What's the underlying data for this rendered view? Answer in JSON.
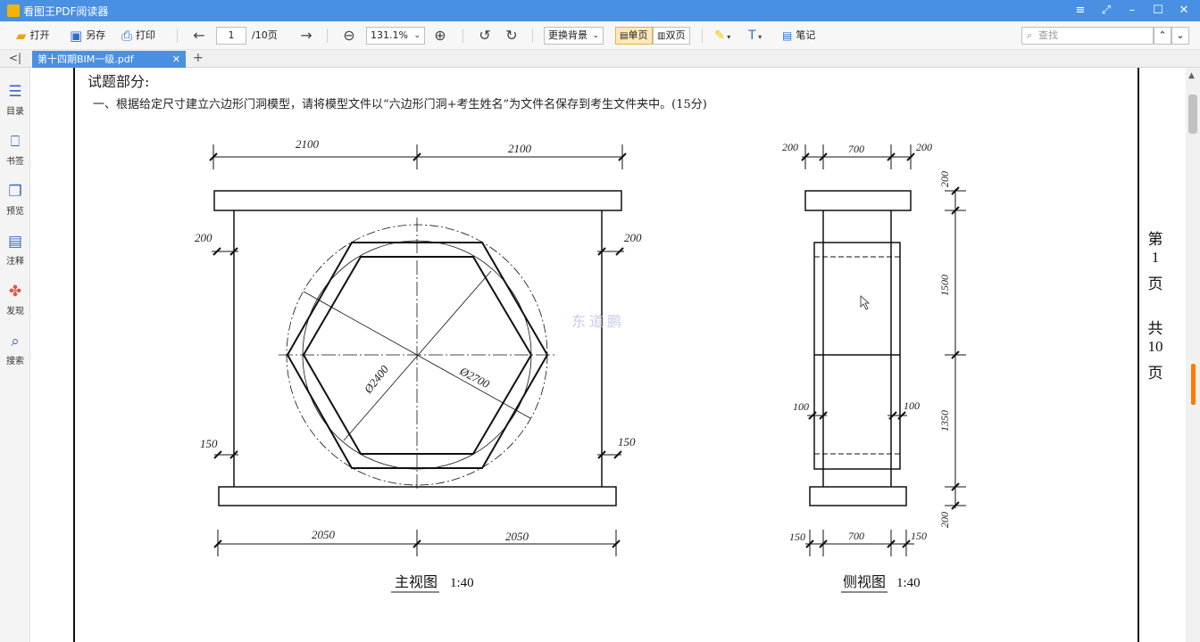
{
  "window": {
    "title": "看图王PDF阅读器",
    "controls": [
      "≡",
      "⤢",
      "–",
      "☐",
      "✕"
    ]
  },
  "toolbar": {
    "open": "打开",
    "save_as": "另存",
    "print": "打印",
    "page_input": "1",
    "page_total": "/10页",
    "zoom": "131.1%",
    "bg_label": "更换背景",
    "single": "单页",
    "double": "双页",
    "note": "笔记",
    "search_placeholder": "查找"
  },
  "tabs": {
    "active": "第十四期BIM一级.pdf"
  },
  "sidebar": {
    "items": [
      {
        "label": "目录",
        "icon": "toc-icon"
      },
      {
        "label": "书签",
        "icon": "bookmark-icon"
      },
      {
        "label": "预览",
        "icon": "preview-icon"
      },
      {
        "label": "注释",
        "icon": "annotation-icon"
      },
      {
        "label": "发现",
        "icon": "discover-icon"
      },
      {
        "label": "搜索",
        "icon": "search-icon"
      }
    ]
  },
  "document": {
    "section_title": "试题部分:",
    "question": "一、根据给定尺寸建立六边形门洞模型，请将模型文件以“六边形门洞+考生姓名”为文件名保存到考生文件夹中。(15分)",
    "front_view": {
      "caption": "主视图",
      "scale": "1:40",
      "top_left": "2100",
      "top_right": "2100",
      "left_upper": "200",
      "right_upper": "200",
      "left_lower": "150",
      "right_lower": "150",
      "bottom_left": "2050",
      "bottom_right": "2050",
      "inner_diameter": "Ø2400",
      "outer_diameter": "Ø2700",
      "watermark": "东 道 鹏"
    },
    "side_view": {
      "caption": "侧视图",
      "scale": "1:40",
      "top_a": "200",
      "top_b": "700",
      "top_c": "200",
      "bot_a": "150",
      "bot_b": "700",
      "bot_c": "150",
      "mid_left": "100",
      "mid_right": "100",
      "v1": "200",
      "v2": "1500",
      "v3": "1350",
      "v4": "200"
    },
    "page_side": {
      "chars": [
        "第",
        "1",
        "页",
        "共",
        "10",
        "页"
      ]
    }
  }
}
